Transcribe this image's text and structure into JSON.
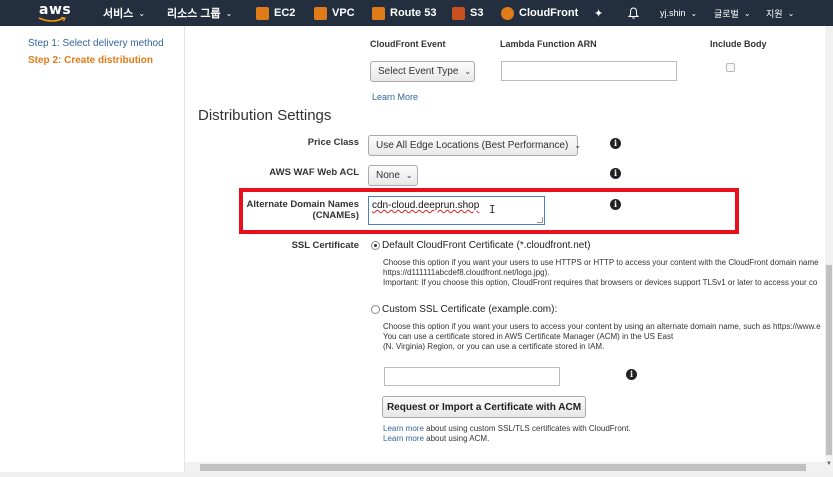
{
  "nav": {
    "logo": "aws",
    "services": "서비스",
    "resource_groups": "리소스 그룹",
    "shortcuts": [
      {
        "label": "EC2",
        "icon": "ec2-icon"
      },
      {
        "label": "VPC",
        "icon": "vpc-icon"
      },
      {
        "label": "Route 53",
        "icon": "route53-icon"
      },
      {
        "label": "S3",
        "icon": "s3-icon"
      },
      {
        "label": "CloudFront",
        "icon": "cloudfront-icon"
      }
    ],
    "user": "yj.shin",
    "region": "글로벌",
    "support": "지원",
    "colors": {
      "bar": "#232f3e",
      "service_icon": "#e07b19"
    }
  },
  "sidebar": {
    "step1": "Step 1: Select delivery method",
    "step2": "Step 2: Create distribution"
  },
  "lambda": {
    "col_event": "CloudFront Event",
    "col_arn": "Lambda Function ARN",
    "col_body": "Include Body",
    "event_select": "Select Event Type",
    "learn_more": "Learn More"
  },
  "distribution": {
    "title": "Distribution Settings",
    "price_class_label": "Price Class",
    "price_class_value": "Use All Edge Locations (Best Performance)",
    "waf_label": "AWS WAF Web ACL",
    "waf_value": "None",
    "cname_label_1": "Alternate Domain Names",
    "cname_label_2": "(CNAMEs)",
    "cname_value": "cdn-cloud.deeprun.shop",
    "ssl_label": "SSL Certificate",
    "ssl_default_label": "Default CloudFront Certificate (*.cloudfront.net)",
    "ssl_default_desc_1": "Choose this option if you want your users to use HTTPS or HTTP to access your content with the CloudFront domain name",
    "ssl_default_desc_2": "https://d111111abcdef8.cloudfront.net/logo.jpg).",
    "ssl_default_desc_3": "Important: If you choose this option, CloudFront requires that browsers or devices support TLSv1 or later to access your co",
    "ssl_custom_label": "Custom SSL Certificate (example.com):",
    "ssl_custom_desc_1": "Choose this option if you want your users to access your content by using an alternate domain name, such as https://www.e",
    "ssl_custom_desc_2": "You can use a certificate stored in AWS Certificate Manager (ACM) in the US East",
    "ssl_custom_desc_3": "(N. Virginia) Region, or you can use a certificate stored in IAM.",
    "acm_button": "Request or Import a Certificate with ACM",
    "learn_more_1_link": "Learn more",
    "learn_more_1_text": " about using custom SSL/TLS certificates with CloudFront.",
    "learn_more_2_link": "Learn more",
    "learn_more_2_text": " about using ACM.",
    "highlight_color": "#e8101a"
  }
}
